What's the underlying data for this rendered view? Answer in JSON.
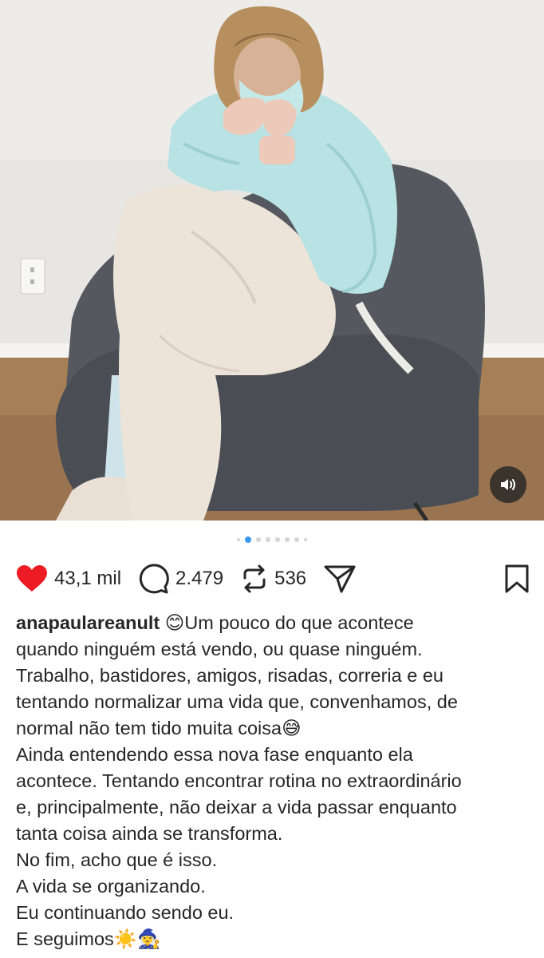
{
  "post": {
    "carousel": {
      "total": 8,
      "active_index": 1
    },
    "actions": {
      "likes": "43,1 mil",
      "comments": "2.479",
      "reposts": "536"
    },
    "caption": {
      "username": "anapaulareanult",
      "line0_rest": " 😊Um pouco do que acontece",
      "lines": [
        "quando ninguém está vendo, ou quase ninguém.",
        "Trabalho, bastidores, amigos, risadas, correria e eu",
        "tentando normalizar uma vida que, convenhamos, de",
        "normal não tem tido muita coisa😅",
        "Ainda entendendo essa nova fase enquanto ela",
        "acontece. Tentando encontrar rotina no extraordinário",
        "e, principalmente, não deixar a vida passar enquanto",
        "tanta coisa ainda se transforma.",
        "No fim, acho que é isso.",
        "A vida se organizando.",
        "Eu continuando sendo eu.",
        "E seguimos☀️🧙‍♀️"
      ]
    }
  },
  "colors": {
    "like": "#ed1c24",
    "active_dot": "#3897f0",
    "text": "#262626"
  },
  "icons": [
    "heart-icon",
    "comment-icon",
    "repost-icon",
    "share-icon",
    "bookmark-icon",
    "speaker-icon"
  ]
}
